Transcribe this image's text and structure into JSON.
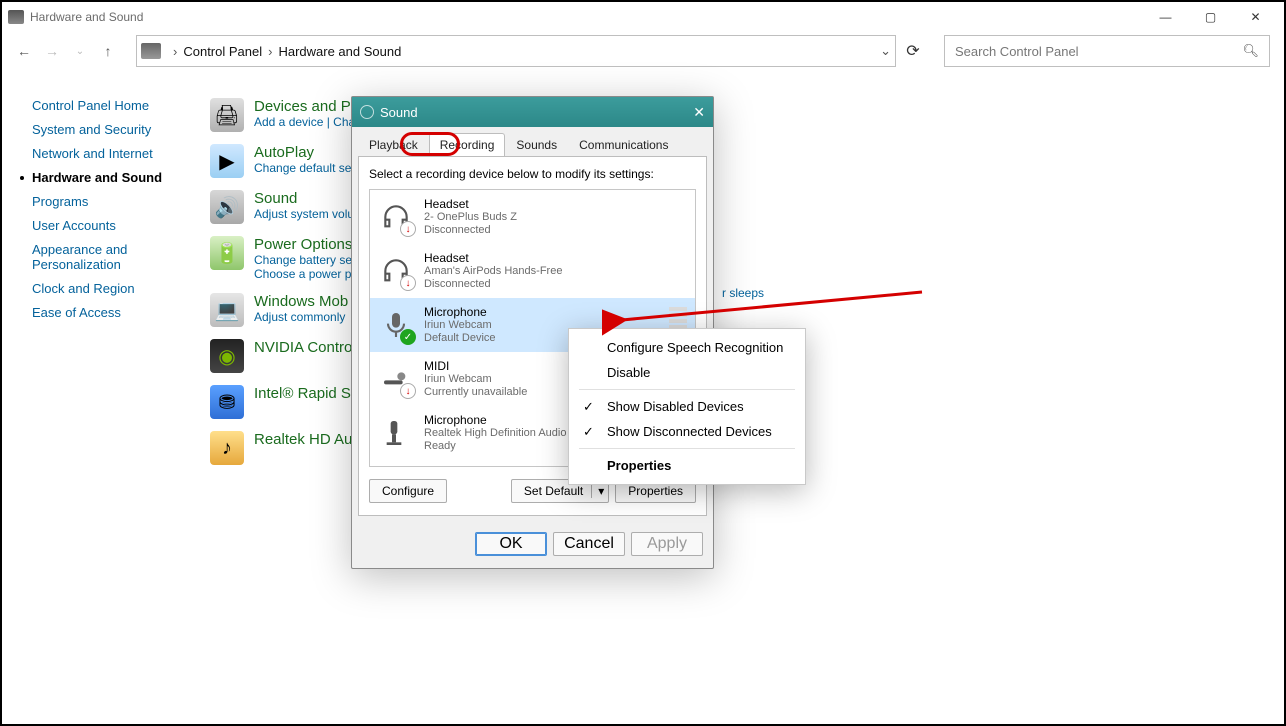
{
  "window": {
    "title": "Hardware and Sound"
  },
  "breadcrumb": {
    "root": "Control Panel",
    "current": "Hardware and Sound"
  },
  "search": {
    "placeholder": "Search Control Panel"
  },
  "sidebar": {
    "home": "Control Panel Home",
    "items": [
      {
        "label": "System and Security"
      },
      {
        "label": "Network and Internet"
      },
      {
        "label": "Hardware and Sound",
        "active": true
      },
      {
        "label": "Programs"
      },
      {
        "label": "User Accounts"
      },
      {
        "label": "Appearance and Personalization"
      },
      {
        "label": "Clock and Region"
      },
      {
        "label": "Ease of Access"
      }
    ]
  },
  "categories": [
    {
      "title": "Devices and P",
      "subs": "Add a device   |   Change Windows"
    },
    {
      "title": "AutoPlay",
      "subs": "Change default set"
    },
    {
      "title": "Sound",
      "subs": "Adjust system volu"
    },
    {
      "title": "Power Options",
      "subs": "Change battery set\nChoose a power pl"
    },
    {
      "title": "Windows Mob",
      "subs": "Adjust commonly"
    },
    {
      "title": "NVIDIA Contro",
      "subs": ""
    },
    {
      "title": "Intel® Rapid S",
      "subs": ""
    },
    {
      "title": "Realtek HD Au",
      "subs": ""
    }
  ],
  "floating_text": "r sleeps",
  "sound_dialog": {
    "title": "Sound",
    "tabs": [
      "Playback",
      "Recording",
      "Sounds",
      "Communications"
    ],
    "active_tab": "Recording",
    "instruction": "Select a recording device below to modify its settings:",
    "devices": [
      {
        "name": "Headset",
        "sub": "2- OnePlus Buds Z",
        "state": "Disconnected",
        "badge": "red"
      },
      {
        "name": "Headset",
        "sub": "Aman's AirPods Hands-Free",
        "state": "Disconnected",
        "badge": "red"
      },
      {
        "name": "Microphone",
        "sub": "Iriun Webcam",
        "state": "Default Device",
        "badge": "green",
        "selected": true
      },
      {
        "name": "MIDI",
        "sub": "Iriun Webcam",
        "state": "Currently unavailable",
        "badge": "red"
      },
      {
        "name": "Microphone",
        "sub": "Realtek High Definition Audio",
        "state": "Ready",
        "badge": "none"
      }
    ],
    "btn_configure": "Configure",
    "btn_setdefault": "Set Default",
    "btn_properties": "Properties",
    "btn_ok": "OK",
    "btn_cancel": "Cancel",
    "btn_apply": "Apply"
  },
  "context_menu": {
    "items": [
      {
        "label": "Configure Speech Recognition"
      },
      {
        "label": "Disable",
        "highlight": true
      },
      {
        "sep": true
      },
      {
        "label": "Show Disabled Devices",
        "checked": true
      },
      {
        "label": "Show Disconnected Devices",
        "checked": true
      },
      {
        "sep": true
      },
      {
        "label": "Properties",
        "bold": true
      }
    ]
  }
}
